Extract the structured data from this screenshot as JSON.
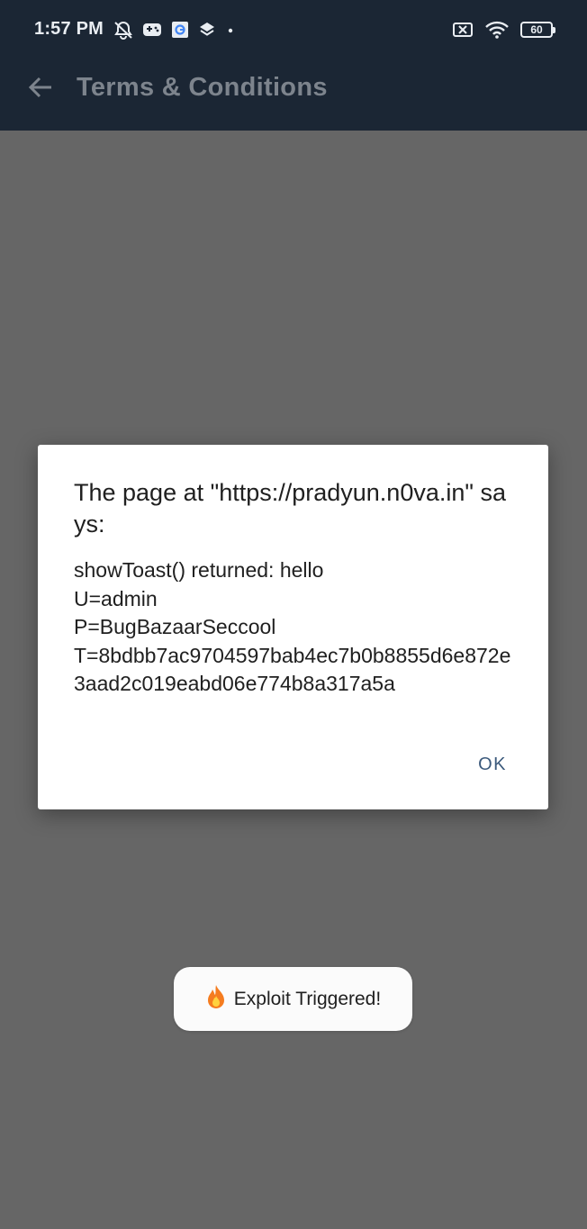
{
  "status_bar": {
    "time": "1:57 PM",
    "battery_level": "60",
    "icons_left": [
      "alarm-off-icon",
      "gamepad-icon",
      "google-icon",
      "layers-icon",
      "dot-icon"
    ],
    "icons_right": [
      "no-sim-icon",
      "wifi-icon",
      "battery-icon"
    ]
  },
  "app_bar": {
    "title": "Terms & Conditions",
    "back_icon": "back-arrow-icon"
  },
  "dialog": {
    "title": "The page at \"https://pradyun.n0va.in\" says:",
    "message": "showToast() returned: hello\nU=admin\nP=BugBazaarSeccool\nT=8bdbb7ac9704597bab4ec7b0b8855d6e872e3aad2c019eabd06e774b8a317a5a",
    "ok_label": "OK"
  },
  "toast": {
    "icon": "fire-icon",
    "text": "Exploit Triggered!"
  },
  "colors": {
    "topbar": "#1b2634",
    "scrim": "#666666",
    "accent": "#3c5a7c"
  }
}
